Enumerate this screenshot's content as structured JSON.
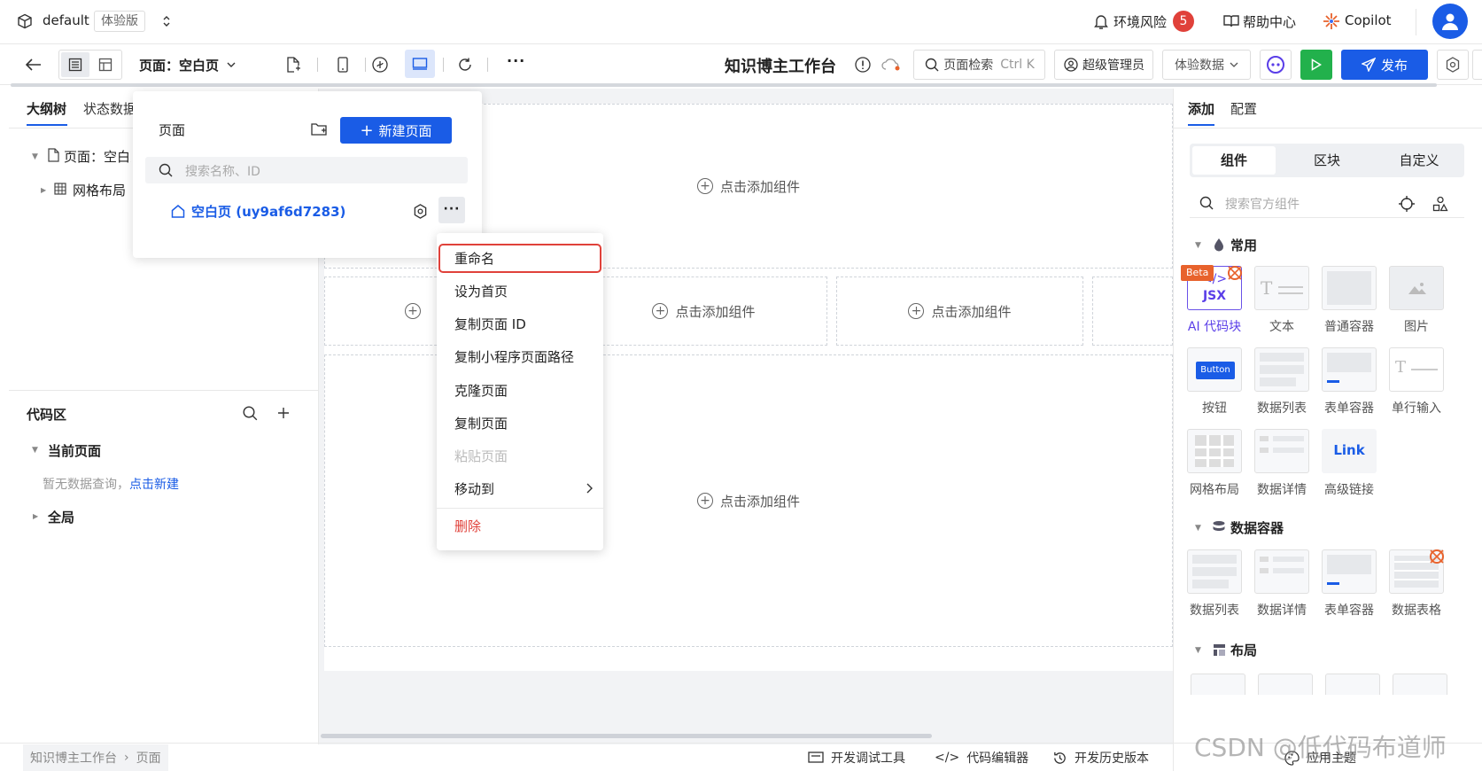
{
  "topbar": {
    "app_name": "default",
    "edition_badge": "体验版",
    "env_risk_label": "环境风险",
    "env_risk_count": "5",
    "help_label": "帮助中心",
    "copilot_label": "Copilot"
  },
  "toolbar": {
    "page_selector": "页面：空白页",
    "app_title": "知识博主工作台",
    "page_search_placeholder": "页面检索",
    "page_search_shortcut": "Ctrl K",
    "admin_label": "超级管理员",
    "data_mode": "体验数据",
    "publish_label": "发布",
    "more": "···"
  },
  "left_panel": {
    "tabs": [
      "大纲树",
      "状态数据"
    ],
    "tree": [
      {
        "label": "页面：空白页"
      },
      {
        "label": "网格布局"
      }
    ],
    "code_section_title": "代码区",
    "current_page_label": "当前页面",
    "empty_hint": "暂无数据查询，",
    "create_link": "点击新建",
    "global_label": "全局"
  },
  "page_popover": {
    "title": "页面",
    "new_page_button": "新建页面",
    "search_placeholder": "搜索名称、ID",
    "page_item": "空白页 (uy9af6d7283)",
    "more": "···"
  },
  "context_menu": {
    "items": [
      "重命名",
      "设为首页",
      "复制页面 ID",
      "复制小程序页面路径",
      "克隆页面",
      "复制页面",
      "粘贴页面",
      "移动到",
      "删除"
    ]
  },
  "canvas": {
    "add_component_label": "点击添加组件"
  },
  "right_panel": {
    "tabs": [
      "添加",
      "配置"
    ],
    "segments": [
      "组件",
      "区块",
      "自定义"
    ],
    "search_placeholder": "搜索官方组件",
    "groups": [
      {
        "title": "常用",
        "items": [
          "AI 代码块",
          "文本",
          "普通容器",
          "图片",
          "按钮",
          "数据列表",
          "表单容器",
          "单行输入",
          "网格布局",
          "数据详情",
          "高级链接"
        ]
      },
      {
        "title": "数据容器",
        "items": [
          "数据列表",
          "数据详情",
          "表单容器",
          "数据表格"
        ]
      },
      {
        "title": "布局",
        "items": []
      }
    ],
    "beta_badge": "Beta",
    "jsx_label": "JSX",
    "button_preview": "Button",
    "link_preview": "Link"
  },
  "statusbar": {
    "breadcrumb": [
      "知识博主工作台",
      "页面"
    ],
    "dev_tools": "开发调试工具",
    "code_editor": "代码编辑器",
    "history": "开发历史版本",
    "theme": "应用主题"
  },
  "watermark": "CSDN @低代码布道师",
  "colors": {
    "primary": "#1a5ce6",
    "run": "#22b14c",
    "danger": "#e0413a",
    "highlight_border": "#e0413a"
  }
}
